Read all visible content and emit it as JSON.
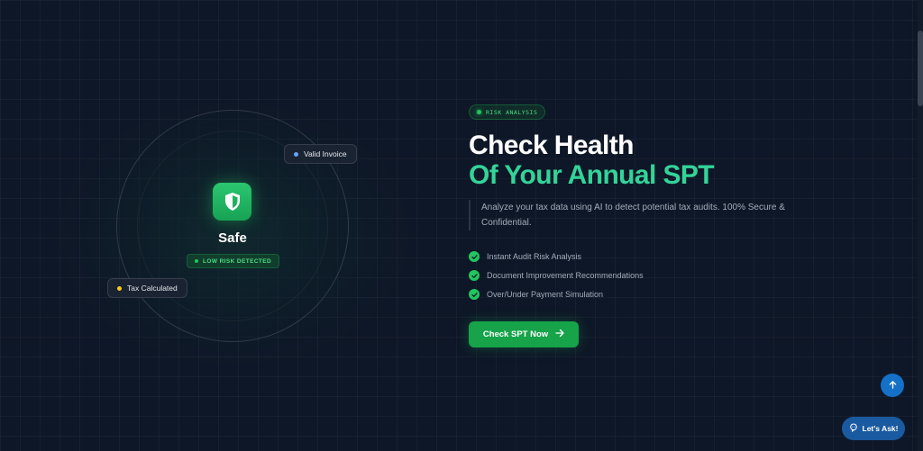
{
  "visual": {
    "status": "Safe",
    "risk_badge": "LOW RISK DETECTED",
    "chips": [
      {
        "label": "Valid Invoice",
        "dot_color": "#60a5fa"
      },
      {
        "label": "Tax Calculated",
        "dot_color": "#facc15"
      }
    ],
    "icon": "shield-icon"
  },
  "hero": {
    "tag": "RISK ANALYSIS",
    "title_line1": "Check Health",
    "title_line2": "Of Your Annual SPT",
    "description": "Analyze your tax data using AI to detect potential tax audits. 100% Secure & Confidential.",
    "features": [
      "Instant Audit Risk Analysis",
      "Document Improvement Recommendations",
      "Over/Under Payment Simulation"
    ],
    "cta_label": "Check SPT Now"
  },
  "floating": {
    "ask_label": "Let's Ask!"
  },
  "colors": {
    "accent_green": "#34d399",
    "button_green": "#16a34a",
    "background": "#0e1727",
    "blue": "#1570c7"
  }
}
